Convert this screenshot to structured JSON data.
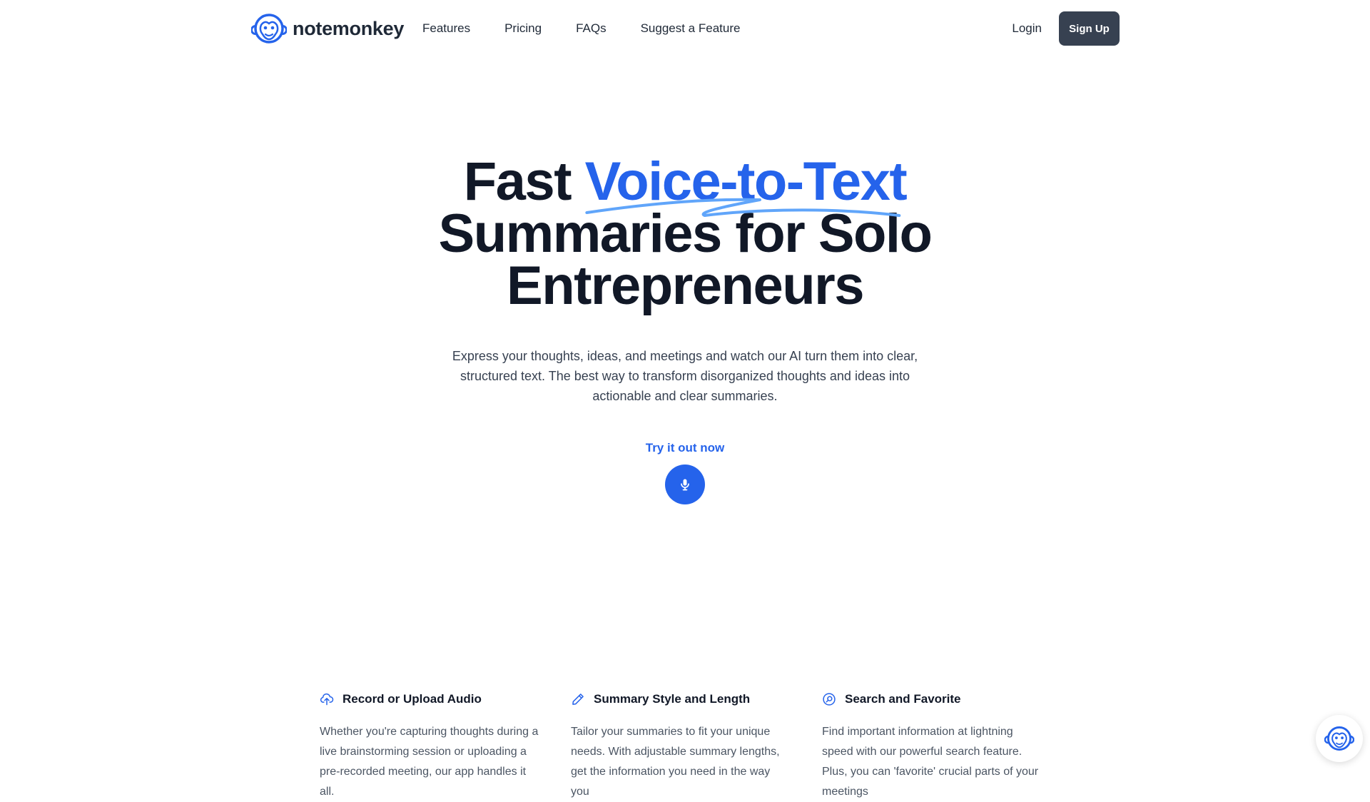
{
  "brand": {
    "name": "notemonkey",
    "accent_color": "#2563eb",
    "dark_color": "#374151"
  },
  "nav": {
    "links": [
      {
        "label": "Features"
      },
      {
        "label": "Pricing"
      },
      {
        "label": "FAQs"
      },
      {
        "label": "Suggest a Feature"
      }
    ],
    "login_label": "Login",
    "signup_label": "Sign Up"
  },
  "hero": {
    "headline_prefix": "Fast",
    "headline_accent": "Voice-to-Text",
    "headline_line2": "Summaries for Solo",
    "headline_line3": "Entrepreneurs",
    "subtext": "Express your thoughts, ideas, and meetings and watch our AI turn them into clear, structured text. The best way to transform disorganized thoughts and ideas into actionable and clear summaries.",
    "cta_label": "Try it out now",
    "cta_icon": "microphone-icon"
  },
  "features": [
    {
      "icon": "cloud-upload-icon",
      "title": "Record or Upload Audio",
      "text": "Whether you're capturing thoughts during a live brainstorming session or uploading a pre-recorded meeting, our app handles it all."
    },
    {
      "icon": "pencil-icon",
      "title": "Summary Style and Length",
      "text": "Tailor your summaries to fit your unique needs. With adjustable summary lengths, get the information you need in the way you"
    },
    {
      "icon": "search-icon",
      "title": "Search and Favorite",
      "text": "Find important information at lightning speed with our powerful search feature. Plus, you can 'favorite' crucial parts of your meetings"
    }
  ],
  "chat_widget": {
    "icon": "monkey-icon"
  }
}
